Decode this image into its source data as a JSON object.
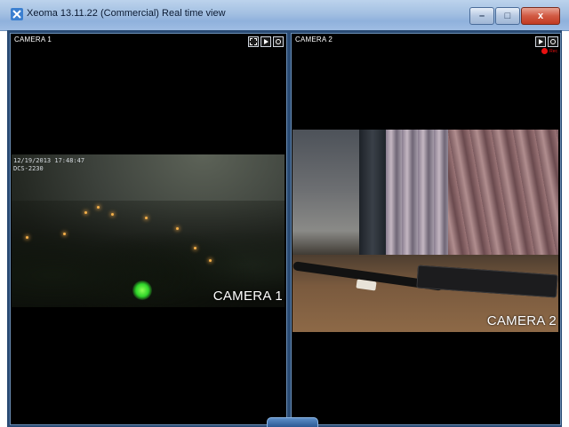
{
  "window": {
    "title": "Xeoma 13.11.22 (Commercial) Real time view",
    "buttons": {
      "minimize": "–",
      "maximize": "□",
      "close": "x"
    }
  },
  "cameras": [
    {
      "label": "CAMERA 1",
      "overlay": "CAMERA 1",
      "osd_line1": "12/19/2013 17:48:47",
      "osd_line2": "DCS-2230",
      "controls": [
        "fullscreen-icon",
        "play-icon",
        "snapshot-icon"
      ]
    },
    {
      "label": "CAMERA 2",
      "overlay": "CAMERA 2",
      "rec_label": "Rec",
      "controls": [
        "play-icon",
        "snapshot-icon"
      ]
    }
  ],
  "colors": {
    "titlebar": "#a3c0e2",
    "frame": "#2a4b74",
    "rec_indicator": "#e81010"
  }
}
